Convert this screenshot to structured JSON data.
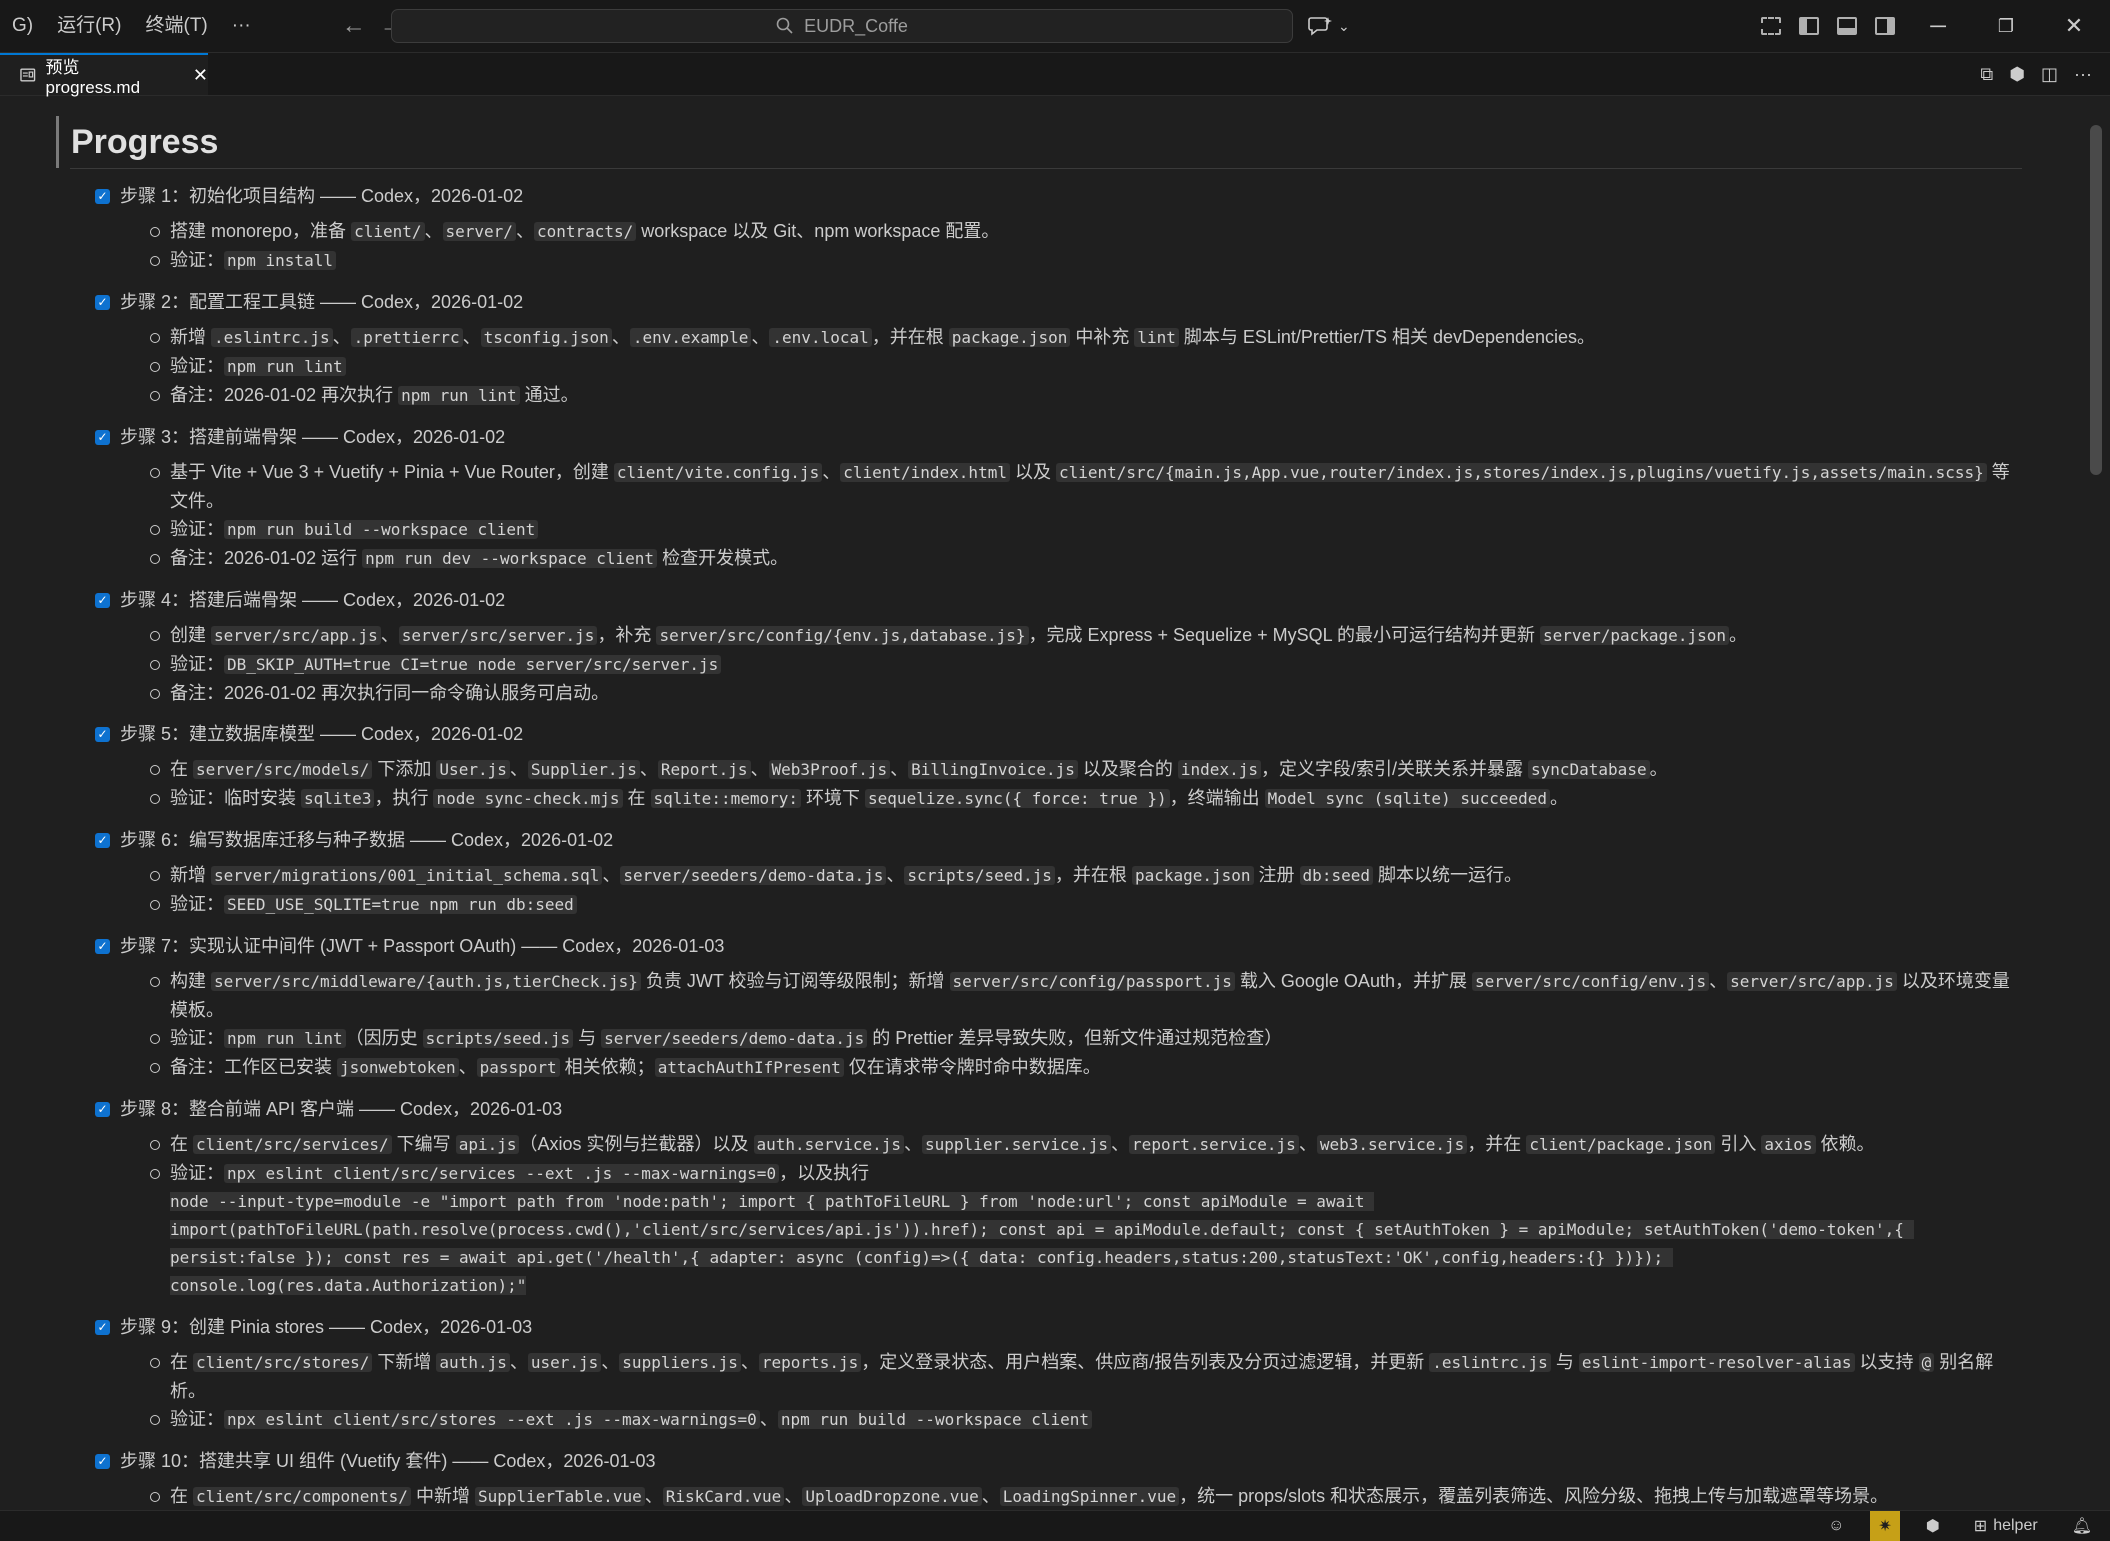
{
  "titlebar": {
    "menus": [
      "G)",
      "运行(R)",
      "终端(T)",
      "···"
    ],
    "search_text": "EUDR_Coffe"
  },
  "tab": {
    "label": "预览 progress.md"
  },
  "doc": {
    "title": "Progress",
    "steps": [
      {
        "heading": "步骤 1：初始化项目结构 —— Codex，2026-01-02",
        "items": [
          [
            [
              "t",
              "搭建 monorepo，准备 "
            ],
            [
              "c",
              "client/"
            ],
            [
              "t",
              "、"
            ],
            [
              "c",
              "server/"
            ],
            [
              "t",
              "、"
            ],
            [
              "c",
              "contracts/"
            ],
            [
              "t",
              " workspace 以及 Git、npm workspace 配置。"
            ]
          ],
          [
            [
              "t",
              "验证："
            ],
            [
              "c",
              "npm install"
            ]
          ]
        ]
      },
      {
        "heading": "步骤 2：配置工程工具链 —— Codex，2026-01-02",
        "items": [
          [
            [
              "t",
              "新增 "
            ],
            [
              "c",
              ".eslintrc.js"
            ],
            [
              "t",
              "、"
            ],
            [
              "c",
              ".prettierrc"
            ],
            [
              "t",
              "、"
            ],
            [
              "c",
              "tsconfig.json"
            ],
            [
              "t",
              "、"
            ],
            [
              "c",
              ".env.example"
            ],
            [
              "t",
              "、"
            ],
            [
              "c",
              ".env.local"
            ],
            [
              "t",
              "，并在根 "
            ],
            [
              "c",
              "package.json"
            ],
            [
              "t",
              " 中补充 "
            ],
            [
              "c",
              "lint"
            ],
            [
              "t",
              " 脚本与 ESLint/Prettier/TS 相关 devDependencies。"
            ]
          ],
          [
            [
              "t",
              "验证："
            ],
            [
              "c",
              "npm run lint"
            ]
          ],
          [
            [
              "t",
              "备注：2026-01-02 再次执行 "
            ],
            [
              "c",
              "npm run lint"
            ],
            [
              "t",
              " 通过。"
            ]
          ]
        ]
      },
      {
        "heading": "步骤 3：搭建前端骨架 —— Codex，2026-01-02",
        "items": [
          [
            [
              "t",
              "基于 Vite + Vue 3 + Vuetify + Pinia + Vue Router，创建 "
            ],
            [
              "c",
              "client/vite.config.js"
            ],
            [
              "t",
              "、"
            ],
            [
              "c",
              "client/index.html"
            ],
            [
              "t",
              " 以及 "
            ],
            [
              "c",
              "client/src/{main.js,App.vue,router/index.js,stores/index.js,plugins/vuetify.js,assets/main.scss}"
            ],
            [
              "t",
              " 等文件。"
            ]
          ],
          [
            [
              "t",
              "验证："
            ],
            [
              "c",
              "npm run build --workspace client"
            ]
          ],
          [
            [
              "t",
              "备注：2026-01-02 运行 "
            ],
            [
              "c",
              "npm run dev --workspace client"
            ],
            [
              "t",
              " 检查开发模式。"
            ]
          ]
        ]
      },
      {
        "heading": "步骤 4：搭建后端骨架 —— Codex，2026-01-02",
        "items": [
          [
            [
              "t",
              "创建 "
            ],
            [
              "c",
              "server/src/app.js"
            ],
            [
              "t",
              "、"
            ],
            [
              "c",
              "server/src/server.js"
            ],
            [
              "t",
              "，补充 "
            ],
            [
              "c",
              "server/src/config/{env.js,database.js}"
            ],
            [
              "t",
              "，完成 Express + Sequelize + MySQL 的最小可运行结构并更新 "
            ],
            [
              "c",
              "server/package.json"
            ],
            [
              "t",
              "。"
            ]
          ],
          [
            [
              "t",
              "验证："
            ],
            [
              "c",
              "DB_SKIP_AUTH=true CI=true node server/src/server.js"
            ]
          ],
          [
            [
              "t",
              "备注：2026-01-02 再次执行同一命令确认服务可启动。"
            ]
          ]
        ]
      },
      {
        "heading": "步骤 5：建立数据库模型 —— Codex，2026-01-02",
        "items": [
          [
            [
              "t",
              "在 "
            ],
            [
              "c",
              "server/src/models/"
            ],
            [
              "t",
              " 下添加 "
            ],
            [
              "c",
              "User.js"
            ],
            [
              "t",
              "、"
            ],
            [
              "c",
              "Supplier.js"
            ],
            [
              "t",
              "、"
            ],
            [
              "c",
              "Report.js"
            ],
            [
              "t",
              "、"
            ],
            [
              "c",
              "Web3Proof.js"
            ],
            [
              "t",
              "、"
            ],
            [
              "c",
              "BillingInvoice.js"
            ],
            [
              "t",
              " 以及聚合的 "
            ],
            [
              "c",
              "index.js"
            ],
            [
              "t",
              "，定义字段/索引/关联关系并暴露 "
            ],
            [
              "c",
              "syncDatabase"
            ],
            [
              "t",
              "。"
            ]
          ],
          [
            [
              "t",
              "验证：临时安装 "
            ],
            [
              "c",
              "sqlite3"
            ],
            [
              "t",
              "，执行 "
            ],
            [
              "c",
              "node sync-check.mjs"
            ],
            [
              "t",
              " 在 "
            ],
            [
              "c",
              "sqlite::memory:"
            ],
            [
              "t",
              " 环境下 "
            ],
            [
              "c",
              "sequelize.sync({ force: true })"
            ],
            [
              "t",
              "，终端输出 "
            ],
            [
              "c",
              "Model sync (sqlite) succeeded"
            ],
            [
              "t",
              "。"
            ]
          ]
        ]
      },
      {
        "heading": "步骤 6：编写数据库迁移与种子数据 —— Codex，2026-01-02",
        "items": [
          [
            [
              "t",
              "新增 "
            ],
            [
              "c",
              "server/migrations/001_initial_schema.sql"
            ],
            [
              "t",
              "、"
            ],
            [
              "c",
              "server/seeders/demo-data.js"
            ],
            [
              "t",
              "、"
            ],
            [
              "c",
              "scripts/seed.js"
            ],
            [
              "t",
              "，并在根 "
            ],
            [
              "c",
              "package.json"
            ],
            [
              "t",
              " 注册 "
            ],
            [
              "c",
              "db:seed"
            ],
            [
              "t",
              " 脚本以统一运行。"
            ]
          ],
          [
            [
              "t",
              "验证："
            ],
            [
              "c",
              "SEED_USE_SQLITE=true npm run db:seed"
            ]
          ]
        ]
      },
      {
        "heading": "步骤 7：实现认证中间件 (JWT + Passport OAuth) —— Codex，2026-01-03",
        "items": [
          [
            [
              "t",
              "构建 "
            ],
            [
              "c",
              "server/src/middleware/{auth.js,tierCheck.js}"
            ],
            [
              "t",
              " 负责 JWT 校验与订阅等级限制；新增 "
            ],
            [
              "c",
              "server/src/config/passport.js"
            ],
            [
              "t",
              " 载入 Google OAuth，并扩展 "
            ],
            [
              "c",
              "server/src/config/env.js"
            ],
            [
              "t",
              "、"
            ],
            [
              "c",
              "server/src/app.js"
            ],
            [
              "t",
              " 以及环境变量模板。"
            ]
          ],
          [
            [
              "t",
              "验证："
            ],
            [
              "c",
              "npm run lint"
            ],
            [
              "t",
              "（因历史 "
            ],
            [
              "c",
              "scripts/seed.js"
            ],
            [
              "t",
              " 与 "
            ],
            [
              "c",
              "server/seeders/demo-data.js"
            ],
            [
              "t",
              " 的 Prettier 差异导致失败，但新文件通过规范检查）"
            ]
          ],
          [
            [
              "t",
              "备注：工作区已安装 "
            ],
            [
              "c",
              "jsonwebtoken"
            ],
            [
              "t",
              "、"
            ],
            [
              "c",
              "passport"
            ],
            [
              "t",
              " 相关依赖；"
            ],
            [
              "c",
              "attachAuthIfPresent"
            ],
            [
              "t",
              " 仅在请求带令牌时命中数据库。"
            ]
          ]
        ]
      },
      {
        "heading": "步骤 8：整合前端 API 客户端 —— Codex，2026-01-03",
        "items": [
          [
            [
              "t",
              "在 "
            ],
            [
              "c",
              "client/src/services/"
            ],
            [
              "t",
              " 下编写 "
            ],
            [
              "c",
              "api.js"
            ],
            [
              "t",
              "（Axios 实例与拦截器）以及 "
            ],
            [
              "c",
              "auth.service.js"
            ],
            [
              "t",
              "、"
            ],
            [
              "c",
              "supplier.service.js"
            ],
            [
              "t",
              "、"
            ],
            [
              "c",
              "report.service.js"
            ],
            [
              "t",
              "、"
            ],
            [
              "c",
              "web3.service.js"
            ],
            [
              "t",
              "，并在 "
            ],
            [
              "c",
              "client/package.json"
            ],
            [
              "t",
              " 引入 "
            ],
            [
              "c",
              "axios"
            ],
            [
              "t",
              " 依赖。"
            ]
          ],
          [
            [
              "t",
              "验证："
            ],
            [
              "c",
              "npx eslint client/src/services --ext .js --max-warnings=0"
            ],
            [
              "t",
              "，以及执行"
            ],
            [
              "b",
              "node --input-type=module -e \"import path from 'node:path'; import { pathToFileURL } from 'node:url'; const apiModule = await import(pathToFileURL(path.resolve(process.cwd(),'client/src/services/api.js')).href); const api = apiModule.default; const { setAuthToken } = apiModule; setAuthToken('demo-token',{ persist:false }); const res = await api.get('/health',{ adapter: async (config)=>({ data: config.headers,status:200,statusText:'OK',config,headers:{} })}); console.log(res.data.Authorization);\""
            ]
          ]
        ]
      },
      {
        "heading": "步骤 9：创建 Pinia stores —— Codex，2026-01-03",
        "items": [
          [
            [
              "t",
              "在 "
            ],
            [
              "c",
              "client/src/stores/"
            ],
            [
              "t",
              " 下新增 "
            ],
            [
              "c",
              "auth.js"
            ],
            [
              "t",
              "、"
            ],
            [
              "c",
              "user.js"
            ],
            [
              "t",
              "、"
            ],
            [
              "c",
              "suppliers.js"
            ],
            [
              "t",
              "、"
            ],
            [
              "c",
              "reports.js"
            ],
            [
              "t",
              "，定义登录状态、用户档案、供应商/报告列表及分页过滤逻辑，并更新 "
            ],
            [
              "c",
              ".eslintrc.js"
            ],
            [
              "t",
              " 与 "
            ],
            [
              "c",
              "eslint-import-resolver-alias"
            ],
            [
              "t",
              " 以支持 "
            ],
            [
              "c",
              "@"
            ],
            [
              "t",
              " 别名解析。"
            ]
          ],
          [
            [
              "t",
              "验证："
            ],
            [
              "c",
              "npx eslint client/src/stores --ext .js --max-warnings=0"
            ],
            [
              "t",
              "、"
            ],
            [
              "c",
              "npm run build --workspace client"
            ]
          ]
        ]
      },
      {
        "heading": "步骤 10：搭建共享 UI 组件 (Vuetify 套件) —— Codex，2026-01-03",
        "items": [
          [
            [
              "t",
              "在 "
            ],
            [
              "c",
              "client/src/components/"
            ],
            [
              "t",
              " 中新增 "
            ],
            [
              "c",
              "SupplierTable.vue"
            ],
            [
              "t",
              "、"
            ],
            [
              "c",
              "RiskCard.vue"
            ],
            [
              "t",
              "、"
            ],
            [
              "c",
              "UploadDropzone.vue"
            ],
            [
              "t",
              "、"
            ],
            [
              "c",
              "LoadingSpinner.vue"
            ],
            [
              "t",
              "，统一 props/slots 和状态展示，覆盖列表筛选、风险分级、拖拽上传与加载遮罩等场景。"
            ]
          ]
        ]
      }
    ]
  },
  "statusbar": {
    "user": "helper"
  }
}
